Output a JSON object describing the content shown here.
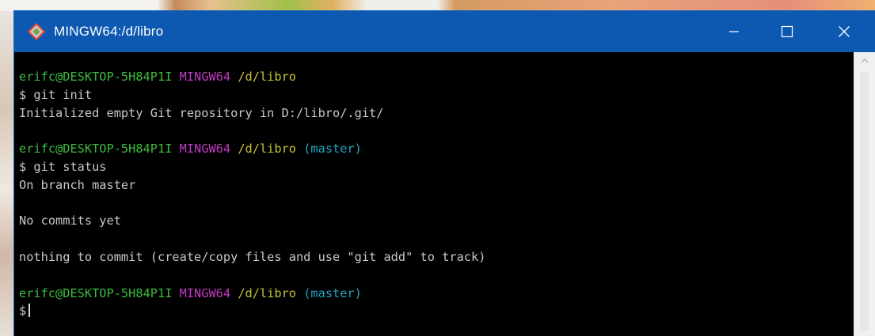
{
  "window": {
    "title": "MINGW64:/d/libro",
    "icons": {
      "app": "git-bash-icon",
      "minimize": "minimize-icon",
      "maximize": "maximize-icon",
      "close": "close-icon"
    },
    "colors": {
      "titlebar": "#0d58b0",
      "terminal_bg": "#000000"
    }
  },
  "terminal": {
    "blocks": [
      {
        "user": "erifc@DESKTOP-5H84P1I",
        "env": "MINGW64",
        "path": "/d/libro",
        "branch": ""
      },
      {
        "user": "erifc@DESKTOP-5H84P1I",
        "env": "MINGW64",
        "path": "/d/libro",
        "branch": "(master)"
      },
      {
        "user": "erifc@DESKTOP-5H84P1I",
        "env": "MINGW64",
        "path": "/d/libro",
        "branch": "(master)"
      }
    ],
    "cmd1": "$ git init",
    "out1": "Initialized empty Git repository in D:/libro/.git/",
    "cmd2": "$ git status",
    "out2a": "On branch master",
    "out2b": "No commits yet",
    "out2c": "nothing to commit (create/copy files and use \"git add\" to track)",
    "prompt3": "$",
    "colors": {
      "user": "#3cbd3c",
      "env": "#c33bc3",
      "path": "#c9c13a",
      "branch": "#1fa7c0",
      "text": "#c8c8c8"
    }
  }
}
